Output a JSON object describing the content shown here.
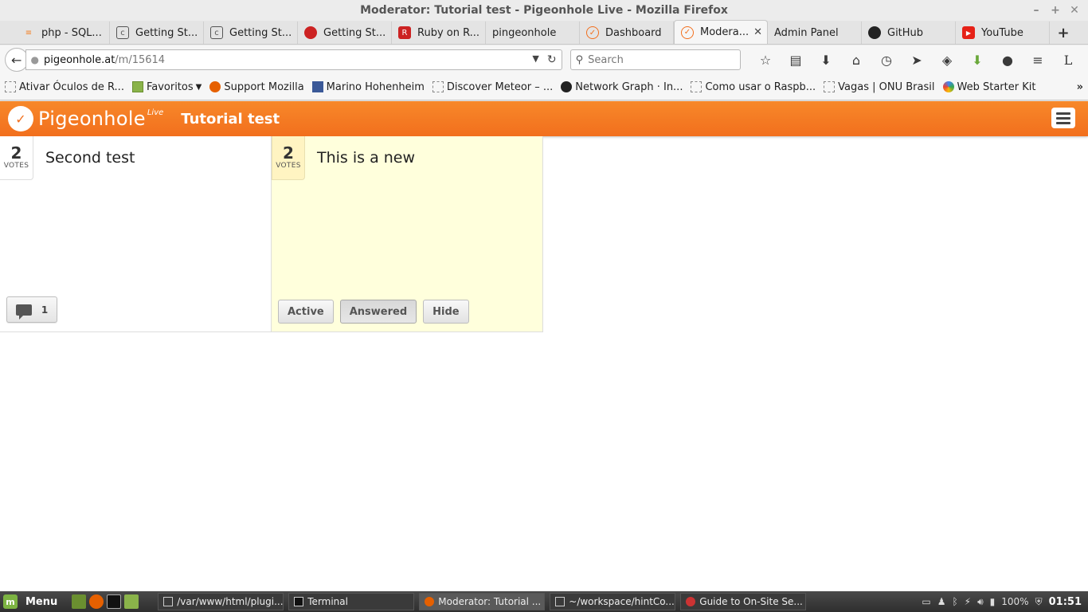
{
  "window": {
    "title": "Moderator: Tutorial test - Pigeonhole Live - Mozilla Firefox"
  },
  "tabs": [
    {
      "label": "php - SQL...",
      "color": "#f48024"
    },
    {
      "label": "Getting St...",
      "color": "#555555"
    },
    {
      "label": "Getting St...",
      "color": "#555555"
    },
    {
      "label": "Getting St...",
      "color": "#cc2222"
    },
    {
      "label": "Ruby on R...",
      "color": "#cc2222"
    },
    {
      "label": "pingeonhole",
      "color": ""
    },
    {
      "label": "Dashboard",
      "color": "#f26f1d"
    },
    {
      "label": "Modera...",
      "color": "#f26f1d",
      "active": true
    },
    {
      "label": "Admin Panel",
      "color": ""
    },
    {
      "label": "GitHub",
      "color": "#222222"
    },
    {
      "label": "YouTube",
      "color": "#e62117"
    }
  ],
  "nav": {
    "url_host": "pigeonhole.at",
    "url_path": "/m/15614",
    "search_placeholder": "Search"
  },
  "bookmarks": [
    "Ativar Óculos de R...",
    "Favoritos",
    "Support Mozilla",
    "Marino Hohenheim",
    "Discover Meteor – ...",
    "Network Graph · In...",
    "Como usar o Raspb...",
    "Vagas | ONU Brasil",
    "Web Starter Kit"
  ],
  "app": {
    "brand": "Pigeonhole",
    "brand_sup": "Live",
    "event_title": "Tutorial test",
    "accent": "#f26f1d"
  },
  "cards": [
    {
      "votes": "2",
      "votes_label": "VOTES",
      "text": "Second test",
      "comments": "1"
    },
    {
      "votes": "2",
      "votes_label": "VOTES",
      "text": "This is a new",
      "actions": [
        "Active",
        "Answered",
        "Hide"
      ]
    }
  ],
  "taskbar": {
    "menu_label": "Menu",
    "tasks": [
      "/var/www/html/plugi...",
      "Terminal",
      "Moderator: Tutorial ...",
      "~/workspace/hintCo...",
      "Guide to On-Site Se..."
    ],
    "battery": "100%",
    "clock": "01:51"
  }
}
